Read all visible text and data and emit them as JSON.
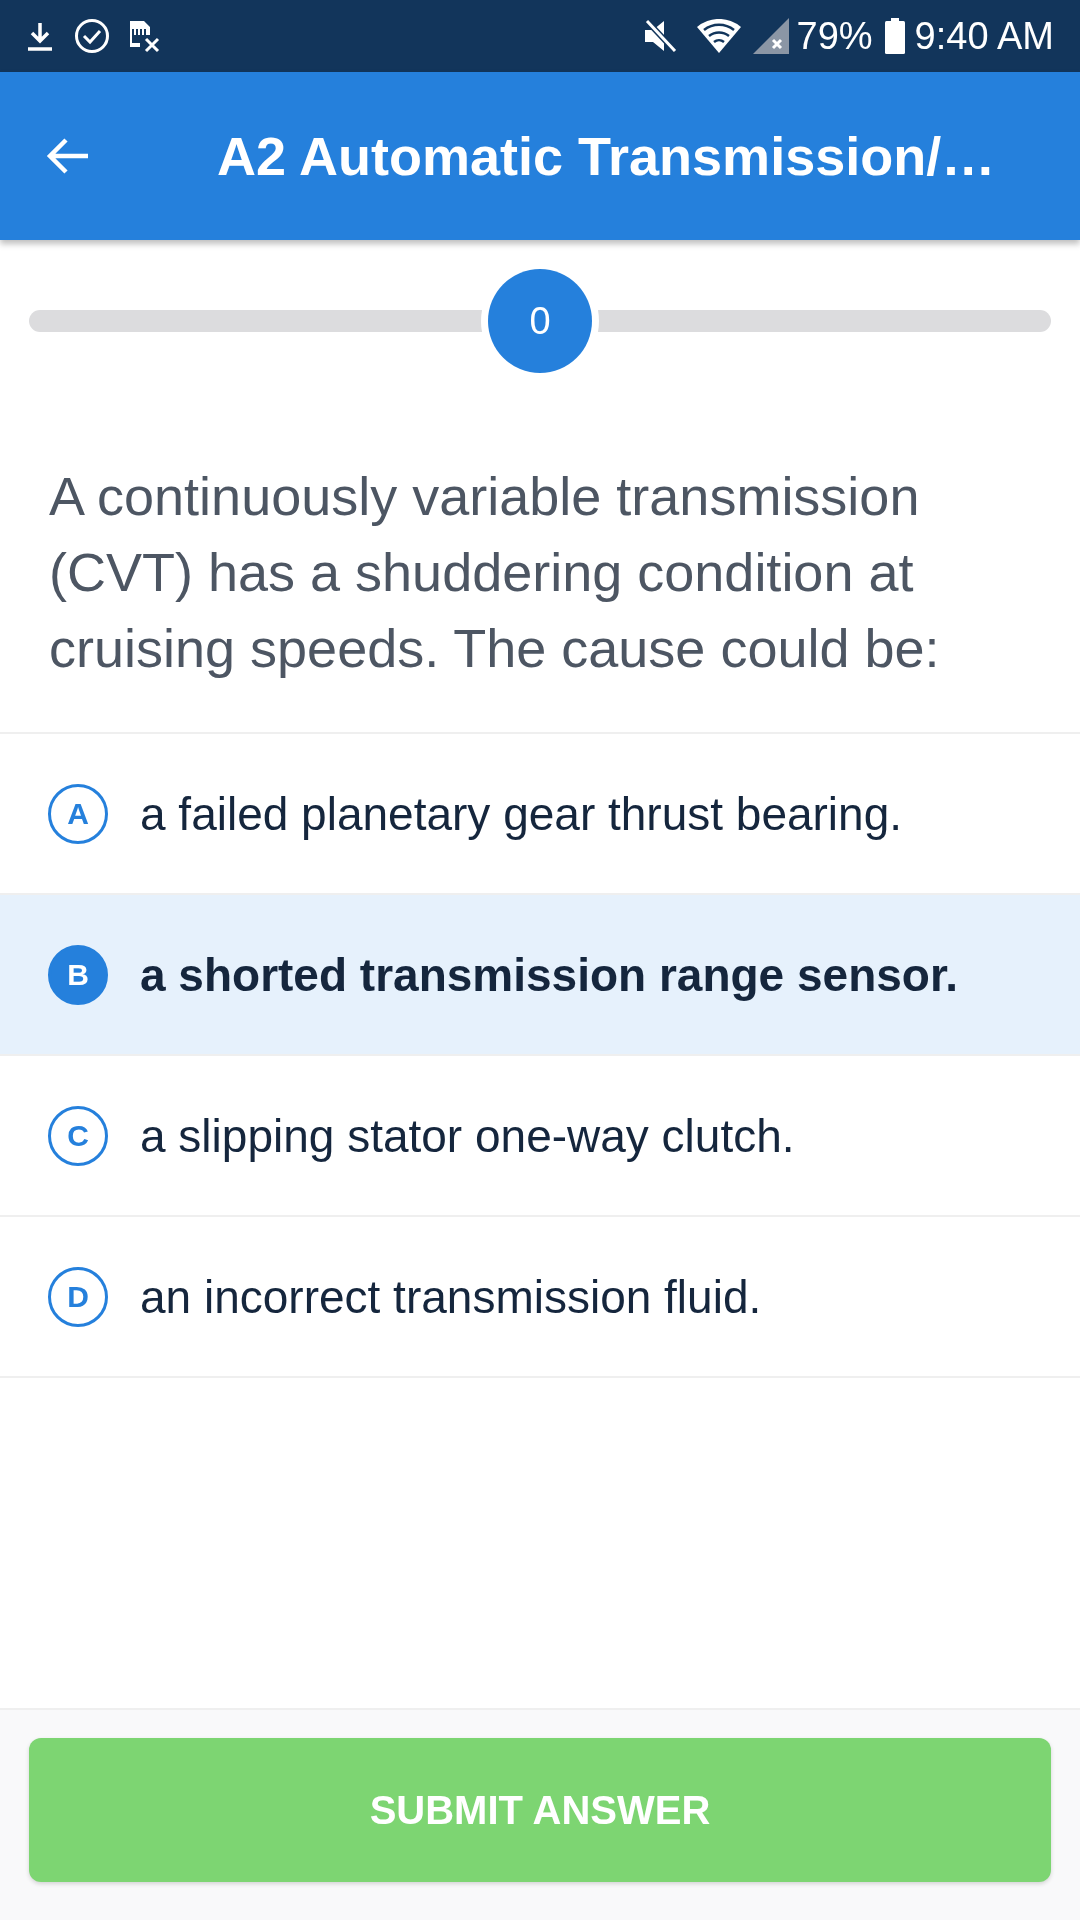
{
  "status_bar": {
    "battery": "79%",
    "time": "9:40 AM"
  },
  "app_bar": {
    "title": "A2 Automatic Transmission/…"
  },
  "progress": {
    "level": 0.5,
    "label": "0"
  },
  "question": {
    "text": "A continuously variable transmission (CVT) has a shuddering condition at cruising speeds. The cause could be:"
  },
  "options": [
    {
      "letter": "A",
      "text": "a failed planetary gear thrust bearing.",
      "selected": false
    },
    {
      "letter": "B",
      "text": "a shorted transmission range sensor.",
      "selected": true
    },
    {
      "letter": "C",
      "text": "a slipping stator one-way clutch.",
      "selected": false
    },
    {
      "letter": "D",
      "text": "an incorrect transmission fluid.",
      "selected": false
    }
  ],
  "submit_button": {
    "label": "SUBMIT ANSWER"
  }
}
